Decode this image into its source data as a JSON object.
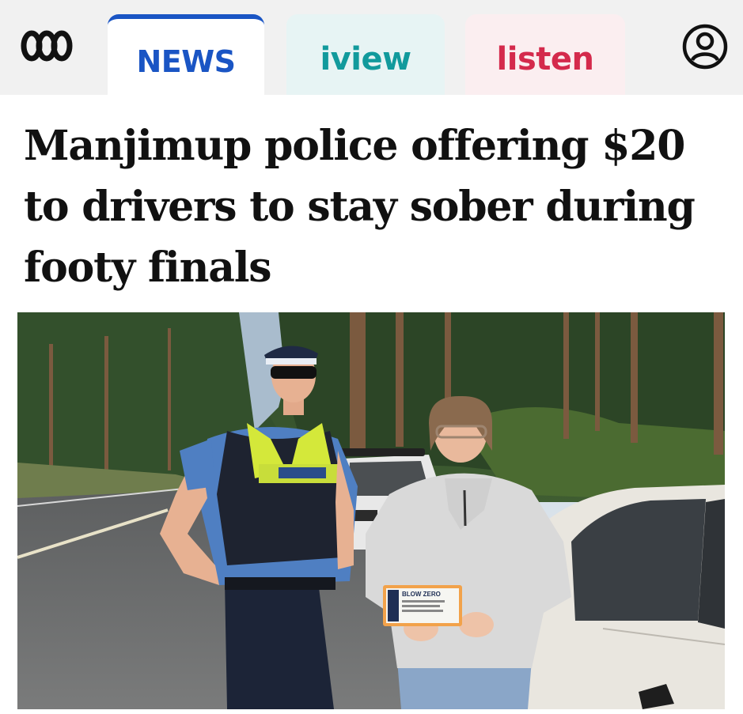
{
  "nav": {
    "logo": "abc-logo",
    "tabs": [
      {
        "label": "NEWS",
        "color": "#1a55c4",
        "active": true
      },
      {
        "label": "iview",
        "color": "#119a9c",
        "active": false
      },
      {
        "label": "listen",
        "color": "#d42a4c",
        "active": false
      }
    ],
    "account_icon": "user-circle-icon"
  },
  "article": {
    "headline": "Manjimup police offering $20 to drivers to stay sober during footy finals",
    "image": {
      "subject": "police-officer-and-woman-holding-voucher",
      "voucher_text": "BLOW ZERO"
    }
  },
  "colors": {
    "nav_bg": "#f1f1f1",
    "news_blue": "#1a55c4",
    "iview_teal": "#119a9c",
    "listen_red": "#d42a4c"
  }
}
